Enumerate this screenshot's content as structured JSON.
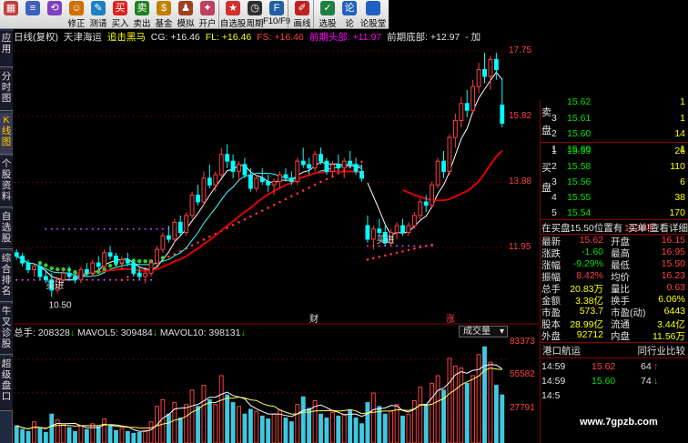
{
  "toolbar": {
    "buttons": [
      {
        "label": "",
        "icon": "grid-icon",
        "color": "#c04040"
      },
      {
        "label": "",
        "icon": "list-icon",
        "color": "#4060c0"
      },
      {
        "label": "",
        "icon": "back-icon",
        "color": "#8040c0"
      },
      {
        "label": "修正",
        "icon": "revise-icon",
        "color": "#d07000"
      },
      {
        "label": "测请",
        "icon": "query-icon",
        "color": "#2080c0"
      },
      {
        "label": "买入",
        "icon": "buy-icon",
        "color": "#e02020"
      },
      {
        "label": "卖出",
        "icon": "sell-icon",
        "color": "#208020"
      },
      {
        "label": "基金",
        "icon": "fund-icon",
        "color": "#c08000"
      },
      {
        "label": "模拟",
        "icon": "simulate-icon",
        "color": "#a04020"
      },
      {
        "label": "开户",
        "icon": "account-icon",
        "color": "#c04060"
      },
      {
        "label": "",
        "icon": "divider-icon",
        "color": "#888888"
      },
      {
        "label": "自选股",
        "icon": "watchlist-icon",
        "color": "#d03030"
      },
      {
        "label": "周期",
        "icon": "period-icon",
        "color": "#303030"
      },
      {
        "label": "F10/F9",
        "icon": "f10-icon",
        "color": "#2060a0"
      },
      {
        "label": "",
        "icon": "divider-icon",
        "color": "#888888"
      },
      {
        "label": "画线",
        "icon": "draw-icon",
        "color": "#c02020"
      },
      {
        "label": "",
        "icon": "divider-icon",
        "color": "#888888"
      },
      {
        "label": "选股",
        "icon": "select-icon",
        "color": "#208040"
      },
      {
        "label": "论",
        "icon": "forum-icon",
        "color": "#2060c0"
      }
    ],
    "extra_label": "论股堂"
  },
  "left_tabs": [
    "应用",
    "分时图",
    "K线图",
    "个股资料",
    "自选股",
    "综合排名",
    "牛叉诊股",
    "超级盘口"
  ],
  "chart_header": {
    "period": "日线(复权)",
    "name": "天津海运",
    "ind1": "追击黑马",
    "cg": "CG: +16.46",
    "fl": "FL: +16.46",
    "fs": "FS: +16.46",
    "top": "前期头部: +11.97",
    "bottom": "前期底部: +12.97",
    "more": "- 加"
  },
  "price_ticks": [
    {
      "label": "17.75",
      "value": 17.75
    },
    {
      "label": "15.82",
      "value": 15.82
    },
    {
      "label": "13.88",
      "value": 13.88
    },
    {
      "label": "11.95",
      "value": 11.95
    }
  ],
  "annotations": {
    "low": "10.50",
    "buy1": "买进",
    "buy2": "买进",
    "finance": "财",
    "rise": "涨"
  },
  "volume": {
    "header_total": "总手: 208328",
    "ma5": "MAVOL5: 309484",
    "ma10": "MAVOL10: 398131",
    "combo": "成交量",
    "ticks": [
      "83373",
      "55582",
      "27791"
    ]
  },
  "orderbook": {
    "sell_label": "卖盘",
    "buy_label": "买盘",
    "sell": [
      {
        "level": "3",
        "price": "15.61",
        "vol": "1"
      },
      {
        "level": "2",
        "price": "15.60",
        "vol": "14"
      },
      {
        "level": "1",
        "price": "15.60",
        "vol": "1"
      }
    ],
    "sell_top_partial": {
      "price": "15.62",
      "vol": "1"
    },
    "buy": [
      {
        "level": "1",
        "price": "15.59",
        "vol": "26"
      },
      {
        "level": "2",
        "price": "15.58",
        "vol": "110"
      },
      {
        "level": "3",
        "price": "15.56",
        "vol": "6"
      },
      {
        "level": "4",
        "price": "15.55",
        "vol": "38"
      },
      {
        "level": "5",
        "price": "15.54",
        "vol": "170"
      }
    ],
    "queue": "在买盘15.50位置有",
    "queue_vol": "1236手",
    "queue_link": "买单!查看详细"
  },
  "stats": [
    {
      "k1": "最新",
      "v1": "15.62",
      "k2": "开盘",
      "v2": "16.15"
    },
    {
      "k1": "涨跌",
      "v1": "-1.60",
      "k2": "最高",
      "v2": "16.95"
    },
    {
      "k1": "涨幅",
      "v1": "-9.29%",
      "k2": "最低",
      "v2": "15.50"
    },
    {
      "k1": "振幅",
      "v1": "8.42%",
      "k2": "均价",
      "v2": "16.23"
    },
    {
      "k1": "总手",
      "v1": "20.83万",
      "k2": "量比",
      "v2": "0.63"
    },
    {
      "k1": "金额",
      "v1": "3.38亿",
      "k2": "换手",
      "v2": "6.06%"
    },
    {
      "k1": "市盈",
      "v1": "573.7",
      "k2": "市盈(动)",
      "v2": "6443"
    },
    {
      "k1": "股本",
      "v1": "28.99亿",
      "k2": "流通",
      "v2": "3.44亿"
    },
    {
      "k1": "外盘",
      "v1": "92712",
      "k2": "内盘",
      "v2": "11.56万"
    }
  ],
  "ticks_panel": {
    "tab1": "港口航运",
    "tab2": "同行业比较",
    "rows": [
      {
        "time": "14:59",
        "price": "15.62",
        "vol": "64",
        "dir": "up"
      },
      {
        "time": "14:59",
        "price": "15.60",
        "vol": "74",
        "dir": "down"
      },
      {
        "time": "14:5",
        "price": "",
        "vol": "",
        "dir": ""
      }
    ]
  },
  "watermark": "www.7gpzb.com",
  "colors": {
    "up": "#ff4040",
    "down": "#00e000",
    "line": "#ffffff",
    "accent": "#ffcc00"
  },
  "chart_data": {
    "type": "candlestick",
    "title": "",
    "ylim": [
      10.0,
      17.75
    ],
    "candles": [
      [
        11.8,
        11.9,
        11.6,
        11.7
      ],
      [
        11.7,
        11.8,
        11.4,
        11.5
      ],
      [
        11.5,
        11.6,
        11.2,
        11.3
      ],
      [
        11.3,
        11.5,
        11.1,
        11.4
      ],
      [
        11.4,
        11.5,
        11.0,
        11.1
      ],
      [
        11.1,
        11.3,
        10.9,
        11.0
      ],
      [
        11.0,
        11.2,
        10.5,
        10.7
      ],
      [
        10.7,
        11.1,
        10.6,
        11.0
      ],
      [
        11.0,
        11.3,
        10.9,
        11.2
      ],
      [
        11.2,
        11.4,
        11.0,
        11.1
      ],
      [
        11.1,
        11.2,
        10.9,
        11.0
      ],
      [
        11.0,
        11.4,
        10.9,
        11.3
      ],
      [
        11.3,
        11.5,
        11.1,
        11.2
      ],
      [
        11.2,
        11.6,
        11.1,
        11.5
      ],
      [
        11.5,
        11.7,
        11.3,
        11.4
      ],
      [
        11.4,
        11.9,
        11.3,
        11.8
      ],
      [
        11.8,
        12.0,
        11.6,
        11.7
      ],
      [
        11.7,
        11.8,
        11.4,
        11.5
      ],
      [
        11.5,
        11.7,
        11.3,
        11.6
      ],
      [
        11.6,
        11.8,
        11.4,
        11.5
      ],
      [
        11.5,
        11.6,
        11.1,
        11.2
      ],
      [
        11.2,
        11.4,
        11.0,
        11.1
      ],
      [
        11.1,
        11.3,
        10.9,
        11.2
      ],
      [
        11.2,
        11.6,
        11.1,
        11.5
      ],
      [
        11.5,
        12.0,
        11.4,
        11.9
      ],
      [
        11.9,
        12.4,
        11.8,
        12.3
      ],
      [
        12.3,
        12.6,
        12.1,
        12.2
      ],
      [
        12.2,
        12.8,
        12.1,
        12.7
      ],
      [
        12.7,
        12.9,
        12.3,
        12.4
      ],
      [
        12.4,
        13.0,
        12.3,
        12.9
      ],
      [
        12.9,
        13.6,
        12.8,
        13.5
      ],
      [
        13.5,
        13.8,
        13.2,
        13.3
      ],
      [
        13.3,
        14.2,
        13.2,
        14.0
      ],
      [
        14.0,
        14.4,
        13.7,
        13.8
      ],
      [
        13.8,
        14.2,
        13.6,
        14.1
      ],
      [
        14.1,
        14.9,
        14.0,
        14.7
      ],
      [
        14.7,
        15.0,
        14.3,
        14.5
      ],
      [
        14.5,
        14.7,
        14.0,
        14.2
      ],
      [
        14.2,
        14.5,
        13.9,
        14.4
      ],
      [
        14.4,
        14.6,
        14.0,
        14.1
      ],
      [
        14.1,
        14.3,
        13.6,
        13.7
      ],
      [
        13.7,
        14.1,
        13.6,
        14.0
      ],
      [
        14.0,
        14.3,
        13.8,
        13.9
      ],
      [
        13.9,
        14.1,
        13.6,
        13.8
      ],
      [
        13.8,
        14.0,
        13.5,
        13.9
      ],
      [
        13.9,
        14.2,
        13.7,
        14.1
      ],
      [
        14.1,
        14.3,
        13.9,
        14.0
      ],
      [
        14.0,
        14.2,
        13.8,
        13.9
      ],
      [
        13.9,
        14.6,
        13.8,
        14.5
      ],
      [
        14.5,
        14.9,
        14.3,
        14.4
      ],
      [
        14.4,
        14.6,
        14.1,
        14.3
      ],
      [
        14.3,
        14.8,
        14.2,
        14.7
      ],
      [
        14.7,
        14.9,
        14.4,
        14.5
      ],
      [
        14.5,
        14.6,
        14.1,
        14.2
      ],
      [
        14.2,
        14.5,
        14.0,
        14.4
      ],
      [
        14.4,
        14.7,
        14.2,
        14.3
      ],
      [
        14.3,
        14.6,
        14.0,
        14.5
      ],
      [
        14.5,
        14.8,
        14.3,
        14.4
      ],
      [
        14.4,
        14.6,
        14.1,
        14.2
      ],
      [
        14.2,
        14.4,
        13.9,
        14.0
      ],
      [
        12.6,
        12.9,
        12.1,
        12.2
      ],
      [
        12.2,
        12.6,
        11.9,
        12.5
      ],
      [
        12.5,
        12.8,
        12.3,
        12.4
      ],
      [
        12.4,
        12.6,
        12.0,
        12.1
      ],
      [
        12.1,
        12.5,
        12.0,
        12.4
      ],
      [
        12.4,
        12.7,
        12.2,
        12.6
      ],
      [
        12.6,
        12.8,
        12.3,
        12.4
      ],
      [
        12.4,
        12.7,
        12.3,
        12.6
      ],
      [
        12.6,
        13.0,
        12.5,
        12.9
      ],
      [
        12.9,
        13.4,
        12.8,
        13.3
      ],
      [
        13.3,
        13.5,
        13.0,
        13.2
      ],
      [
        13.2,
        13.9,
        13.1,
        13.8
      ],
      [
        13.8,
        14.6,
        13.7,
        14.5
      ],
      [
        14.5,
        14.8,
        14.0,
        14.2
      ],
      [
        14.2,
        15.3,
        14.1,
        15.2
      ],
      [
        15.2,
        15.9,
        14.9,
        15.7
      ],
      [
        15.7,
        16.4,
        15.5,
        16.2
      ],
      [
        16.2,
        16.6,
        15.8,
        16.0
      ],
      [
        16.0,
        16.9,
        15.9,
        16.7
      ],
      [
        16.7,
        17.4,
        16.5,
        17.2
      ],
      [
        17.2,
        17.7,
        16.8,
        17.0
      ],
      [
        17.0,
        17.6,
        16.6,
        17.5
      ],
      [
        17.5,
        17.7,
        16.9,
        17.2
      ],
      [
        16.15,
        16.95,
        15.5,
        15.62
      ]
    ],
    "volumes": [
      18,
      14,
      12,
      22,
      15,
      11,
      30,
      24,
      20,
      16,
      12,
      18,
      14,
      20,
      17,
      25,
      19,
      13,
      15,
      12,
      10,
      11,
      13,
      22,
      38,
      45,
      30,
      42,
      26,
      40,
      55,
      38,
      60,
      45,
      40,
      70,
      50,
      42,
      38,
      30,
      35,
      33,
      28,
      25,
      30,
      34,
      26,
      22,
      40,
      48,
      36,
      44,
      30,
      26,
      32,
      28,
      30,
      34,
      26,
      20,
      42,
      52,
      38,
      30,
      33,
      40,
      28,
      30,
      44,
      58,
      40,
      62,
      70,
      55,
      88,
      80,
      78,
      62,
      70,
      92,
      100,
      84,
      60,
      50
    ]
  }
}
